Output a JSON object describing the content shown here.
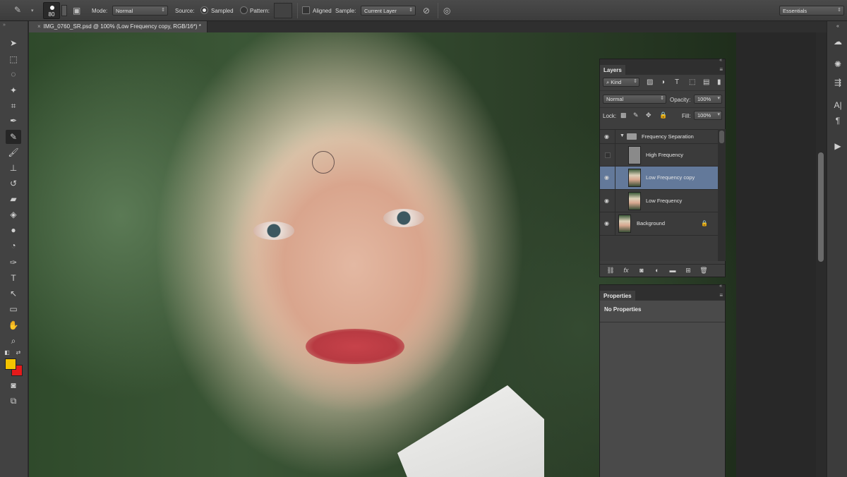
{
  "options_bar": {
    "brush_size": "80",
    "mode_label": "Mode:",
    "mode_value": "Normal",
    "source_label": "Source:",
    "source_sampled": "Sampled",
    "source_pattern": "Pattern:",
    "aligned_label": "Aligned",
    "sample_label": "Sample:",
    "sample_value": "Current Layer",
    "workspace": "Essentials"
  },
  "document": {
    "tab_title": "IMG_0760_SR.psd @ 100% (Low Frequency copy, RGB/16*) *",
    "close_glyph": "×"
  },
  "colors": {
    "foreground": "#f5c400",
    "background": "#e51a1a",
    "selected_layer": "#63799a"
  },
  "layers_panel": {
    "title": "Layers",
    "filter_kind": "Kind",
    "blend_mode": "Normal",
    "opacity_label": "Opacity:",
    "opacity_value": "100%",
    "lock_label": "Lock:",
    "fill_label": "Fill:",
    "fill_value": "100%",
    "layers": [
      {
        "name": "Frequency Separation",
        "type": "group",
        "visible": true
      },
      {
        "name": "High Frequency",
        "type": "layer",
        "visible": false
      },
      {
        "name": "Low Frequency copy",
        "type": "layer",
        "visible": true,
        "selected": true
      },
      {
        "name": "Low Frequency",
        "type": "layer",
        "visible": true
      },
      {
        "name": "Background",
        "type": "layer",
        "visible": true,
        "locked": true
      }
    ]
  },
  "properties_panel": {
    "title": "Properties",
    "message": "No Properties"
  }
}
